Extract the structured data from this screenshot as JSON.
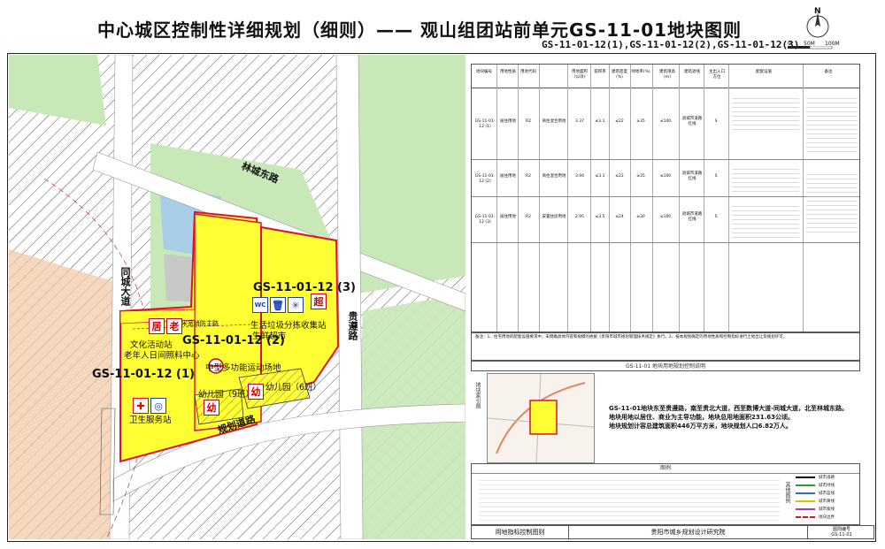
{
  "title": "中心城区控制性详细规划（细则）—— 观山组团站前单元GS-11-01地块图则",
  "subtitle": "GS-11-01-12(1),GS-11-01-12(2),GS-11-01-12(3)",
  "north_label": "N",
  "scale_labels": [
    "0",
    "50M",
    "100M"
  ],
  "map": {
    "roads": {
      "lincheng": "林城东路",
      "tongcheng": "同城大道",
      "guizun": "贵遵路",
      "guihua": "规划道路"
    },
    "parcels": {
      "p1": "GS-11-01-12 (1)",
      "p2": "GS-11-01-12 (2)",
      "p3": "GS-11-01-12 (3)"
    },
    "facilities": {
      "fire_road": "12米宽消防主路",
      "culture": "文化活动站",
      "elderly": "老年人日间照料中心",
      "sports": "中型多功能运动场地",
      "kinder9": "幼儿园（9班）",
      "kinder6": "幼儿园（6班）",
      "health": "卫生服务站",
      "garbage": "生活垃圾分拣收集站",
      "market": "生鲜超市"
    },
    "glyphs": {
      "ju": "居",
      "lao": "老",
      "you": "幼",
      "chao": "超",
      "wc": "WC"
    },
    "colors": {
      "residential": "#ffff33",
      "boundary": "#e0102a",
      "green": "#c8e8b8",
      "commercial": "#f2c8a4",
      "water": "#a9cfe8"
    }
  },
  "table": {
    "headers": [
      "地块编号",
      "用地性质",
      "用地代码",
      "用地面积(公顷)",
      "容积率",
      "建筑密度(%)",
      "绿地率(%)",
      "建筑限高(m)",
      "建筑退线",
      "主出入口方位",
      "配套设施",
      "备注"
    ],
    "rows": [
      {
        "code": "GS-11-01-12 (1)",
        "nature": "居住用地",
        "gb": "R2",
        "type": "商住混合用地",
        "area": "3.37",
        "far": "≤3.1",
        "density": "≤22",
        "green": "≥35",
        "height": "≤100",
        "retreat": "退城市道路红线",
        "entry": "S"
      },
      {
        "code": "GS-11-01-12 (2)",
        "nature": "居住用地",
        "gb": "R2",
        "type": "商住混合用地",
        "area": "3.94",
        "far": "≤3.1",
        "density": "≤22",
        "green": "≥35",
        "height": "≤100",
        "retreat": "退城市道路红线",
        "entry": "S"
      },
      {
        "code": "GS-11-01-12 (3)",
        "nature": "居住用地",
        "gb": "R2",
        "type": "安置住房用地",
        "area": "2.95",
        "far": "≤3.5",
        "density": "≤24",
        "green": "≥30",
        "height": "≤100",
        "retreat": "退城市道路红线",
        "entry": "S"
      }
    ]
  },
  "notes": "备注：1、住宅用地的配套设施要求中，未明确具体内容和规模的依据《贵阳市城市规划管理技术规定》执行。2、按本规划确定的用地性质和控制指标进行土地出让及规划许可。",
  "summary": {
    "section_title": "GS-11-01 地块用地规划控制说明",
    "side_label": "地块索引图",
    "lines": [
      "GS-11-01地块东至贵遵路，南至贵北大道，西至数博大道-同城大道，北至林城东路。",
      "地块用地以居住、商业为主导功能，地块总用地面积231.63公顷。",
      "地块规划计容总建筑面积446万平方米，地块规划人口6.82万人。"
    ]
  },
  "legend": {
    "title": "图例",
    "side_label": "其他图例",
    "lines": [
      "城市道路",
      "城市绿线",
      "城市蓝线",
      "城市黄线",
      "城市紫线",
      "地块边界"
    ]
  },
  "footer": {
    "left": "用地指标控制图则",
    "org": "贵阳市城乡规划设计研究院",
    "id_label": "图则编号",
    "id": "GS-11-01"
  }
}
